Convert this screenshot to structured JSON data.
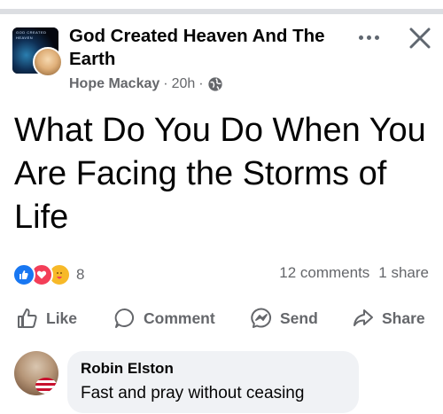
{
  "post": {
    "group_name": "God Created Heaven And The Earth",
    "group_avatar_caption": "GOD CREATED HEAVEN",
    "author": "Hope Mackay",
    "time": "20h",
    "separator": "·",
    "privacy_icon": "globe-icon",
    "text": "What Do You Do When You Are Facing the Storms of Life"
  },
  "reactions": {
    "icons": [
      "like-reaction-icon",
      "love-reaction-icon",
      "care-reaction-icon"
    ],
    "count": "8"
  },
  "stats": {
    "comments": "12 comments",
    "shares": "1 share"
  },
  "actions": {
    "like": "Like",
    "comment": "Comment",
    "send": "Send",
    "share": "Share"
  },
  "comment": {
    "author": "Robin Elston",
    "text": "Fast and pray without ceasing"
  },
  "colors": {
    "brand_blue": "#1877f2",
    "love_red": "#f33e58",
    "care_yellow": "#f7b928",
    "secondary_text": "#65676b",
    "bubble_bg": "#f0f2f5"
  }
}
